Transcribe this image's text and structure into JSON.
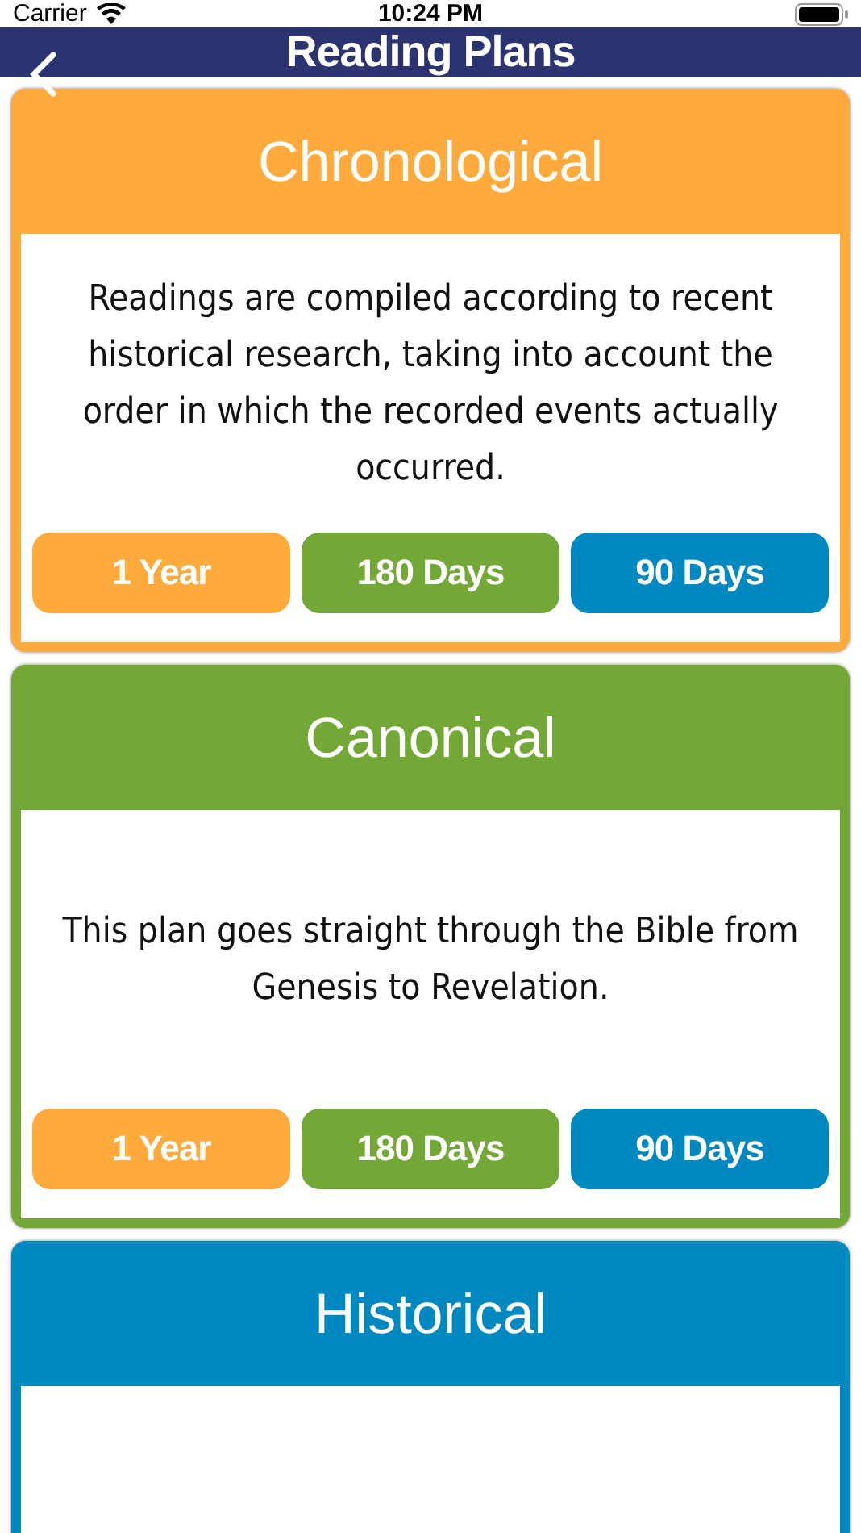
{
  "status_bar": {
    "carrier": "Carrier",
    "time": "10:24 PM"
  },
  "nav": {
    "title": "Reading Plans"
  },
  "plans": [
    {
      "title": "Chronological",
      "color": "#ffaa3c",
      "description": "Readings are compiled according to recent historical research, taking into account the order in which the recorded events actually occurred.",
      "options": [
        {
          "label": "1 Year",
          "color": "#ffaa3c"
        },
        {
          "label": "180 Days",
          "color": "#74a836"
        },
        {
          "label": "90 Days",
          "color": "#0088c0"
        }
      ]
    },
    {
      "title": "Canonical",
      "color": "#74a836",
      "description": "This plan goes straight through the Bible from Genesis to Revelation.",
      "options": [
        {
          "label": "1 Year",
          "color": "#ffaa3c"
        },
        {
          "label": "180 Days",
          "color": "#74a836"
        },
        {
          "label": "90 Days",
          "color": "#0088c0"
        }
      ]
    },
    {
      "title": "Historical",
      "color": "#0088c0"
    }
  ]
}
